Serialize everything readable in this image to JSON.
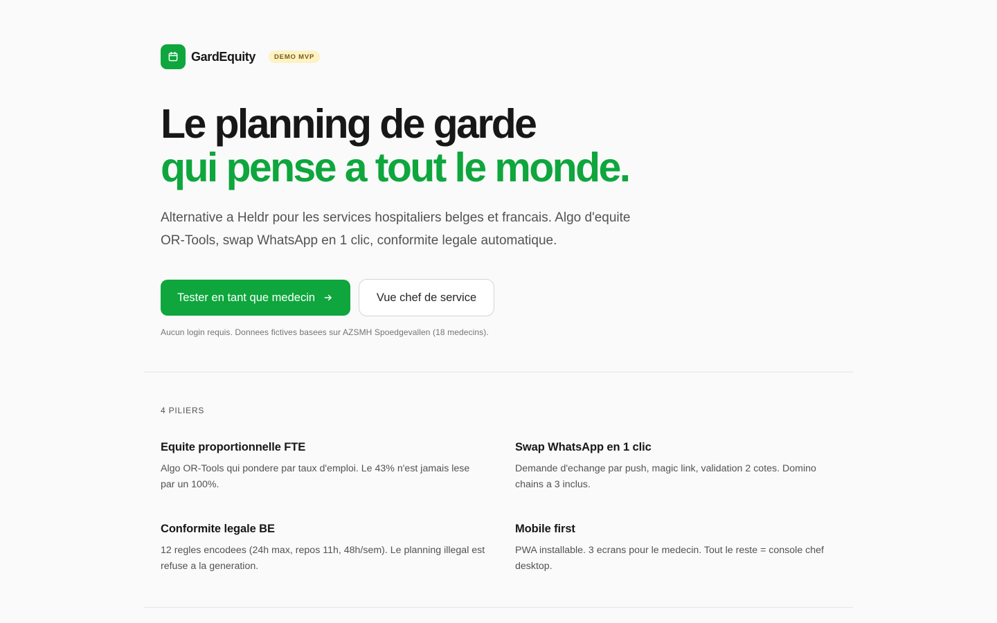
{
  "header": {
    "brand_name": "GardEquity",
    "badge": "DEMO MVP",
    "logo_icon": "calendar-icon"
  },
  "hero": {
    "title_line1": "Le planning de garde",
    "title_line2": "qui pense a tout le monde.",
    "subtitle": "Alternative a Heldr pour les services hospitaliers belges et francais. Algo d'equite OR-Tools, swap WhatsApp en 1 clic, conformite legale automatique.",
    "primary_cta": "Tester en tant que medecin",
    "secondary_cta": "Vue chef de service",
    "note": "Aucun login requis. Donnees fictives basees sur AZSMH Spoedgevallen (18 medecins)."
  },
  "pillars": {
    "label": "4 PILIERS",
    "items": [
      {
        "title": "Equite proportionnelle FTE",
        "description": "Algo OR-Tools qui pondere par taux d'emploi. Le 43% n'est jamais lese par un 100%."
      },
      {
        "title": "Swap WhatsApp en 1 clic",
        "description": "Demande d'echange par push, magic link, validation 2 cotes. Domino chains a 3 inclus."
      },
      {
        "title": "Conformite legale BE",
        "description": "12 regles encodees (24h max, repos 11h, 48h/sem). Le planning illegal est refuse a la generation."
      },
      {
        "title": "Mobile first",
        "description": "PWA installable. 3 ecrans pour le medecin. Tout le reste = console chef desktop."
      }
    ]
  },
  "colors": {
    "accent": "#0ea63d",
    "background": "#fafafa",
    "badge_bg": "#fdf2c4",
    "badge_text": "#7a5a10"
  }
}
